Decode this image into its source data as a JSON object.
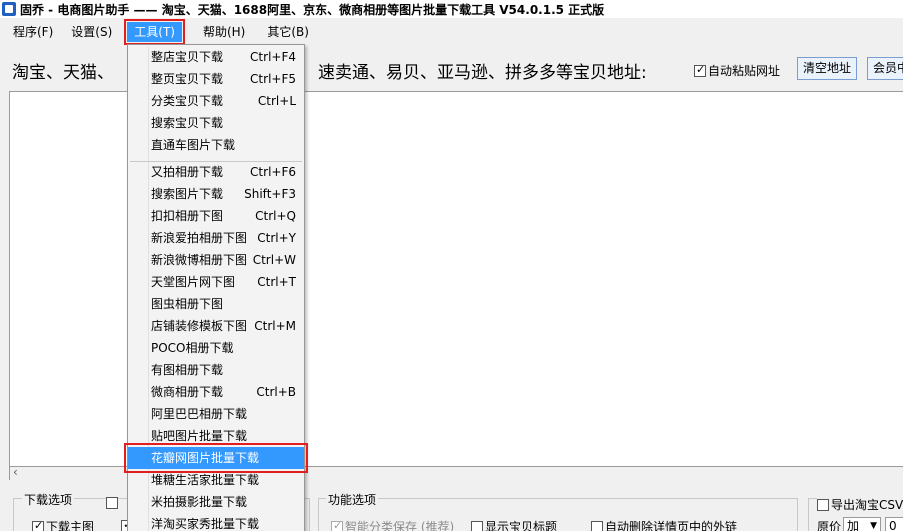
{
  "window": {
    "title": "固乔 - 电商图片助手 —— 淘宝、天猫、1688阿里、京东、微商相册等图片批量下载工具 V54.0.1.5 正式版"
  },
  "menubar": {
    "items": [
      "程序(F)",
      "设置(S)",
      "工具(T)",
      "帮助(H)",
      "其它(B)"
    ]
  },
  "url_row": {
    "prompt_left": "淘宝、天猫、",
    "prompt_right": "速卖通、易贝、亚马逊、拼多多等宝贝地址:",
    "auto_paste_label": "自动粘贴网址",
    "clear_button": "清空地址",
    "member_button": "会员中心"
  },
  "tools_menu": {
    "group1": [
      {
        "label": "整店宝贝下载",
        "shortcut": "Ctrl+F4"
      },
      {
        "label": "整页宝贝下载",
        "shortcut": "Ctrl+F5"
      },
      {
        "label": "分类宝贝下载",
        "shortcut": "Ctrl+L"
      },
      {
        "label": "搜索宝贝下载",
        "shortcut": ""
      },
      {
        "label": "直通车图片下载",
        "shortcut": ""
      }
    ],
    "group2": [
      {
        "label": "又拍相册下载",
        "shortcut": "Ctrl+F6"
      },
      {
        "label": "搜索图片下载",
        "shortcut": "Shift+F3"
      },
      {
        "label": "扣扣相册下图",
        "shortcut": "Ctrl+Q"
      },
      {
        "label": "新浪爱拍相册下图",
        "shortcut": "Ctrl+Y"
      },
      {
        "label": "新浪微博相册下图",
        "shortcut": "Ctrl+W"
      },
      {
        "label": "天堂图片网下图",
        "shortcut": "Ctrl+T"
      },
      {
        "label": "图虫相册下图",
        "shortcut": ""
      },
      {
        "label": "店铺装修模板下图",
        "shortcut": "Ctrl+M"
      },
      {
        "label": "POCO相册下载",
        "shortcut": ""
      },
      {
        "label": "有图相册下载",
        "shortcut": ""
      },
      {
        "label": "微商相册下载",
        "shortcut": "Ctrl+B"
      },
      {
        "label": "阿里巴巴相册下载",
        "shortcut": ""
      },
      {
        "label": "贴吧图片批量下载",
        "shortcut": ""
      },
      {
        "label": "花瓣网图片批量下载",
        "shortcut": ""
      },
      {
        "label": "堆糖生活家批量下载",
        "shortcut": ""
      },
      {
        "label": "米拍摄影批量下载",
        "shortcut": ""
      },
      {
        "label": "洋淘买家秀批量下载",
        "shortcut": ""
      }
    ],
    "highlighted": "花瓣网图片批量下载"
  },
  "bottom": {
    "download_options_title": "下载选项",
    "download_main_image": "下载主图",
    "function_options_title": "功能选项",
    "smart_save": "智能分类保存 (推荐)",
    "show_title": "显示宝贝标题",
    "auto_delete_links": "自动删除详情页中的外链",
    "export_csv": "导出淘宝CSV数据",
    "original_price_label": "原价",
    "price_op": "加",
    "price_value": "0"
  }
}
